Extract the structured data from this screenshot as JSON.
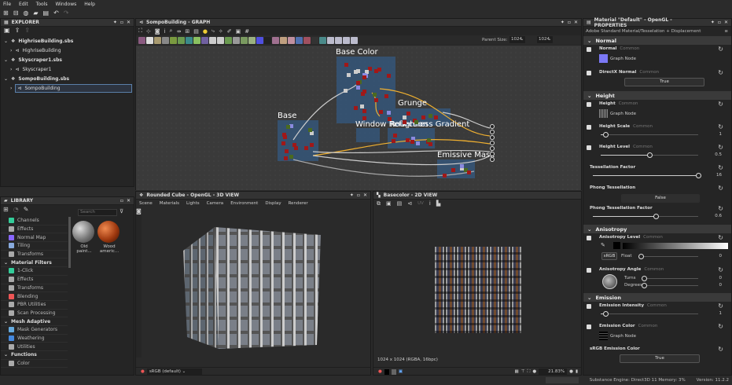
{
  "menu": [
    "File",
    "Edit",
    "Tools",
    "Windows",
    "Help"
  ],
  "explorer": {
    "title": "EXPLORER",
    "packages": [
      {
        "file": "HighriseBuilding.sbs",
        "graph": "HighriseBuilding"
      },
      {
        "file": "Skyscraper1.sbs",
        "graph": "Skyscraper1"
      },
      {
        "file": "SompoBuilding.sbs",
        "graph": "SompoBuilding"
      }
    ]
  },
  "library": {
    "title": "LIBRARY",
    "search_placeholder": "Search",
    "items": [
      {
        "label": "Channels",
        "cat": false,
        "color": "#3c9"
      },
      {
        "label": "Effects",
        "cat": false,
        "color": "#aaa"
      },
      {
        "label": "Normal Map",
        "cat": false,
        "color": "#86f"
      },
      {
        "label": "Tiling",
        "cat": false,
        "color": "#8ad"
      },
      {
        "label": "Transforms",
        "cat": false,
        "color": "#aaa"
      },
      {
        "label": "Material Filters",
        "cat": true
      },
      {
        "label": "1-Click",
        "cat": false,
        "color": "#3c9"
      },
      {
        "label": "Effects",
        "cat": false,
        "color": "#aaa"
      },
      {
        "label": "Transforms",
        "cat": false,
        "color": "#aaa"
      },
      {
        "label": "Blending",
        "cat": false,
        "color": "#e55"
      },
      {
        "label": "PBR Utilities",
        "cat": false,
        "color": "#aaa"
      },
      {
        "label": "Scan Processing",
        "cat": false,
        "color": "#aaa"
      },
      {
        "label": "Mesh Adaptive",
        "cat": true
      },
      {
        "label": "Mask Generators",
        "cat": false,
        "color": "#6ad"
      },
      {
        "label": "Weathering",
        "cat": false,
        "color": "#48d"
      },
      {
        "label": "Utilities",
        "cat": false,
        "color": "#aaa"
      },
      {
        "label": "Functions",
        "cat": true
      },
      {
        "label": "Color",
        "cat": false,
        "color": "#aaa"
      }
    ],
    "thumbs": [
      {
        "label1": "Old",
        "label2": "paint..."
      },
      {
        "label1": "Wood",
        "label2": "americ..."
      }
    ]
  },
  "graph": {
    "title": "SompoBuilding - GRAPH",
    "parent_size_label": "Parent Size:",
    "parent_size": "1024",
    "size2": "1024",
    "frames": [
      "Base Color",
      "Base",
      "Grunge",
      "Window Reflection",
      "Roughness Gradient",
      "Emissive Mask"
    ]
  },
  "view3d": {
    "title": "Rounded Cube - OpenGL - 3D VIEW",
    "menus": [
      "Scene",
      "Materials",
      "Lights",
      "Camera",
      "Environment",
      "Display",
      "Renderer"
    ],
    "colorspace": "sRGB (default)"
  },
  "view2d": {
    "title": "Basecolor - 2D VIEW",
    "info": "1024 x 1024 (RGBA, 16bpc)",
    "zoom": "21.83%",
    "uv": "UV"
  },
  "properties": {
    "title": "Material \"Default\" - OpenGL - PROPERTIES",
    "subtitle": "Adobe Standard Material/Tesselation + Displacement",
    "common": "Common",
    "graph_node": "Graph Node",
    "sections": {
      "normal": "Normal",
      "height": "Height",
      "anisotropy": "Anisotropy",
      "emission": "Emission"
    },
    "normal": {
      "label": "Normal"
    },
    "directx": {
      "label": "DirectX Normal",
      "value": "True"
    },
    "height": {
      "label": "Height"
    },
    "height_scale": {
      "label": "Height Scale",
      "value": "1",
      "fraction": 0.05
    },
    "height_level": {
      "label": "Height Level",
      "value": "0.5",
      "fraction": 0.5
    },
    "tess": {
      "label": "Tessellation Factor",
      "value": "16",
      "fraction": 1.0
    },
    "phong": {
      "label": "Phong Tessellation",
      "value": "False"
    },
    "phong_factor": {
      "label": "Phong Tessellation Factor",
      "value": "0.6",
      "fraction": 0.6
    },
    "aniso_level": {
      "label": "Anisotropy Level",
      "srgb": "sRGB",
      "float": "Float",
      "value": "0"
    },
    "aniso_angle": {
      "label": "Anisotropy Angle",
      "turns": "Turns",
      "degrees": "Degrees",
      "turns_value": "0",
      "degrees_value": "0"
    },
    "emission_intensity": {
      "label": "Emission Intensity",
      "value": "1",
      "fraction": 0.05
    },
    "emission_color": {
      "label": "Emission Color"
    },
    "srgb_emission": {
      "label": "sRGB Emission Color",
      "value": "True"
    }
  },
  "status": {
    "engine": "Substance Engine: Direct3D 11  Memory: 3%",
    "version": "Version: 11.2.2"
  },
  "colors": {
    "wire": "#f0b030",
    "frame": "#345a82",
    "node": "#a01818"
  }
}
